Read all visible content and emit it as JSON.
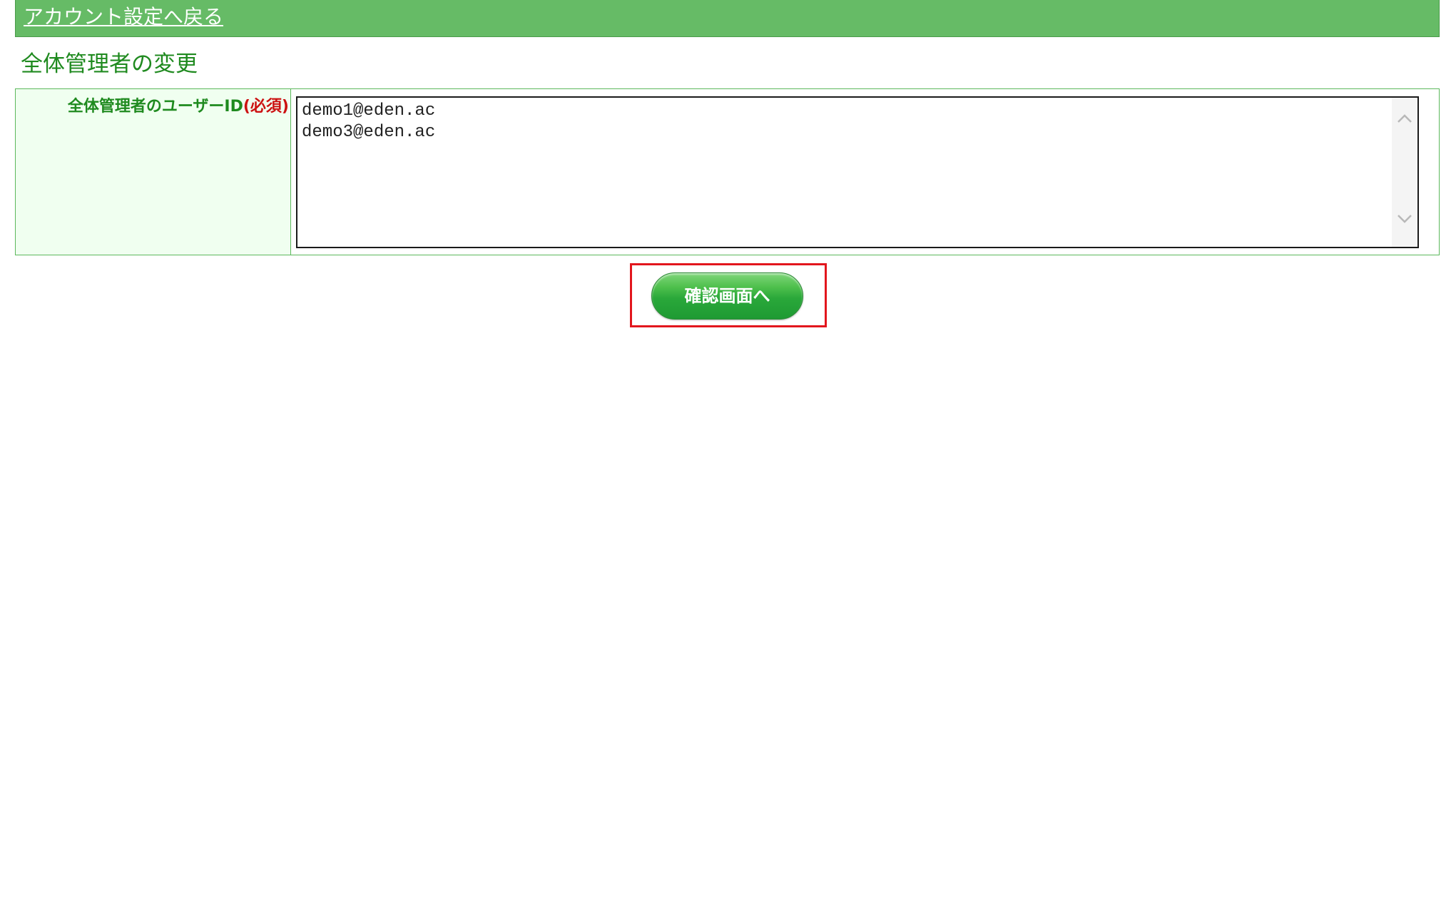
{
  "header": {
    "back_link_label": "アカウント設定へ戻る"
  },
  "page": {
    "title": "全体管理者の変更"
  },
  "form": {
    "field_label": "全体管理者のユーザーID",
    "required_label": "(必須)",
    "admin_user_ids": "demo1@eden.ac\ndemo3@eden.ac"
  },
  "actions": {
    "confirm_label": "確認画面へ"
  },
  "icons": {
    "scroll_up": "chevron-up-icon",
    "scroll_down": "chevron-down-icon"
  },
  "colors": {
    "header_bg": "#66bb66",
    "title_text": "#1f8a1f",
    "required_text": "#cc1111",
    "label_bg": "#f0fff0",
    "button_green": "#2aa83a",
    "highlight_frame": "#e2161d"
  }
}
